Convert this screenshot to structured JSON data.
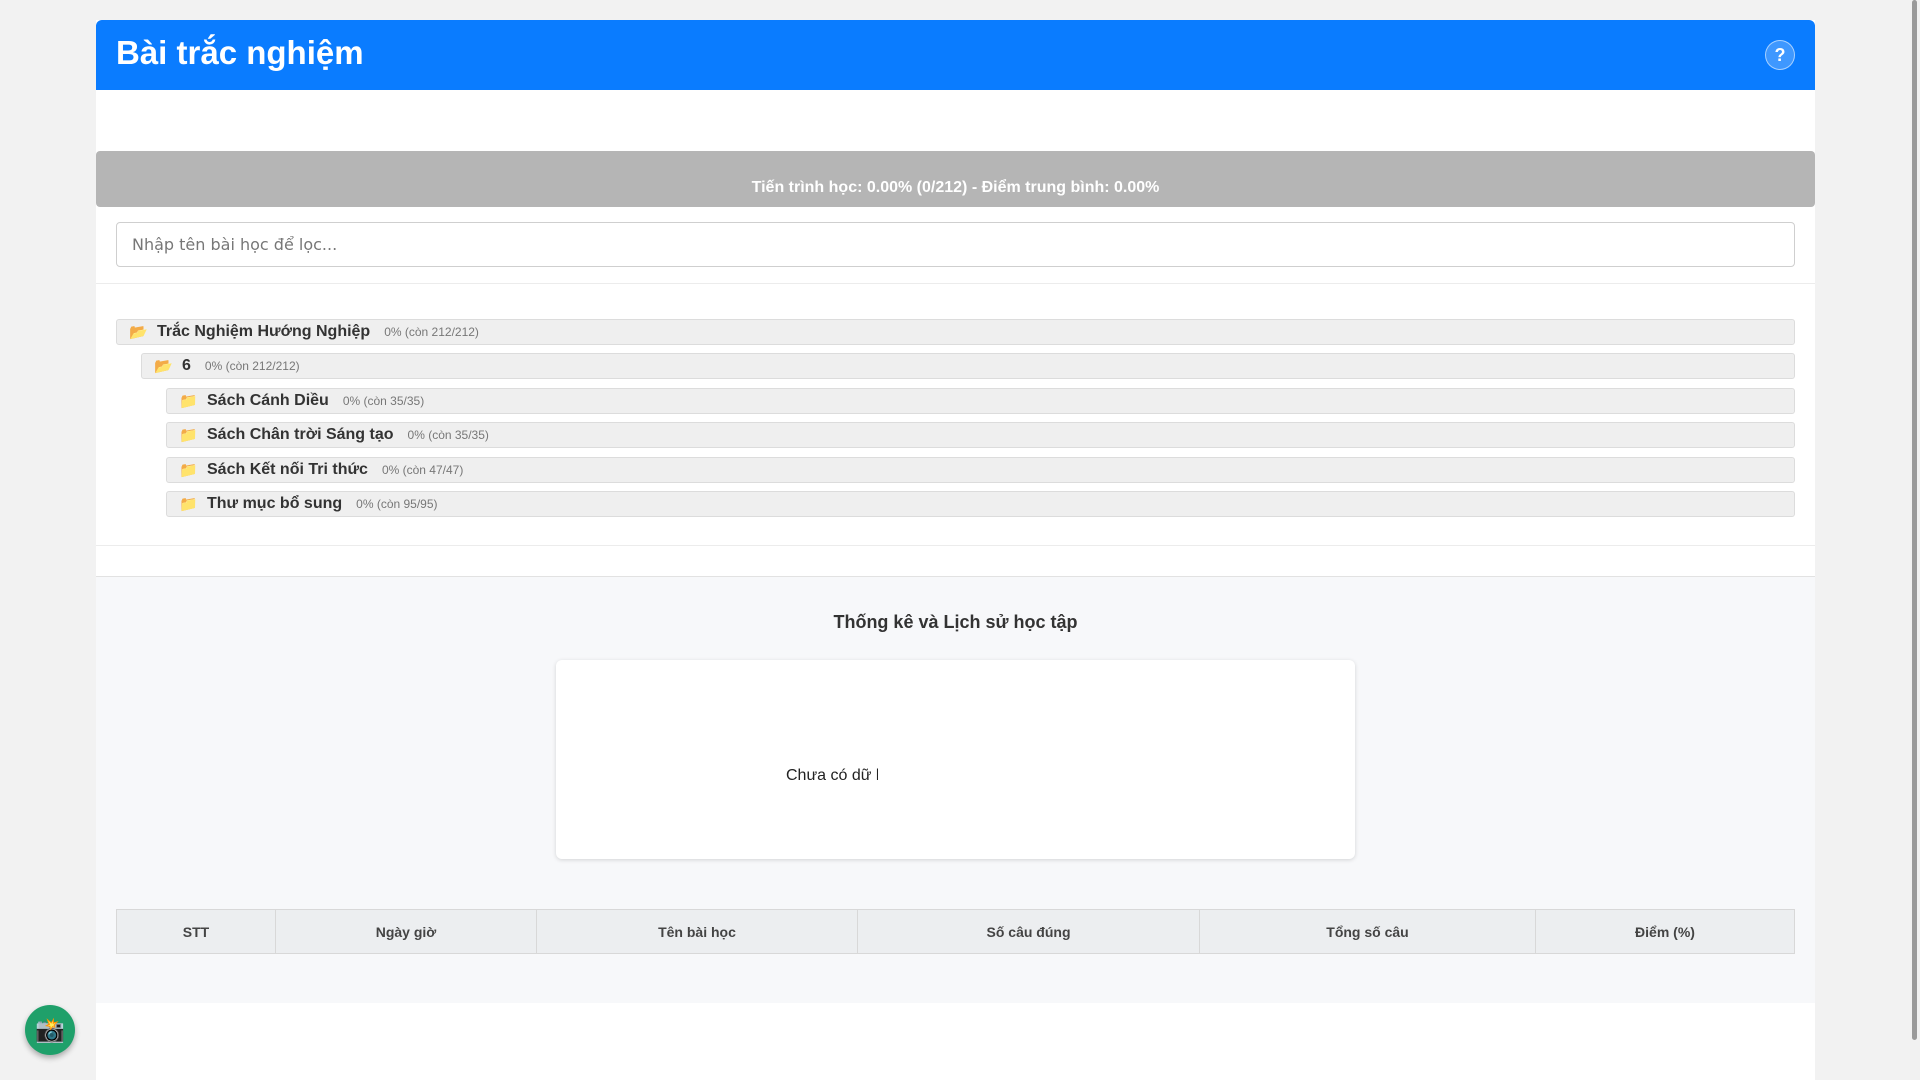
{
  "header": {
    "title": "Bài trắc nghiệm",
    "help_label": "?"
  },
  "progress": {
    "text": "Tiến trình học: 0.00% (0/212) - Điểm trung bình: 0.00%",
    "fraction": 0.0,
    "bar_color": "#b5b5b5"
  },
  "filter": {
    "placeholder": "Nhập tên bài học để lọc...",
    "value": ""
  },
  "tree": {
    "root": {
      "name": "Trắc Nghiệm Hướng Nghiệp",
      "stat": "0% (còn 212/212)",
      "icon": "open-folder-icon"
    },
    "grade": {
      "name": "6",
      "stat": "0% (còn 212/212)",
      "icon": "open-folder-icon"
    },
    "books": [
      {
        "name": "Sách Cánh Diều",
        "stat": "0% (còn 35/35)",
        "icon": "folder-icon"
      },
      {
        "name": "Sách Chân trời Sáng tạo",
        "stat": "0% (còn 35/35)",
        "icon": "folder-icon"
      },
      {
        "name": "Sách Kết nối Tri thức",
        "stat": "0% (còn 47/47)",
        "icon": "folder-icon"
      },
      {
        "name": "Thư mục bổ sung",
        "stat": "0% (còn 95/95)",
        "icon": "folder-icon"
      }
    ]
  },
  "stats": {
    "title": "Thống kê và Lịch sử học tập",
    "chart_empty_text": "Chưa có dữ liệu",
    "table_headers": [
      "STT",
      "Ngày giờ",
      "Tên bài học",
      "Số câu đúng",
      "Tổng số câu",
      "Điểm (%)"
    ]
  },
  "colors": {
    "header": "#0a7cff",
    "camera_button": "#1fa06a"
  },
  "camera": {
    "icon": "camera-icon",
    "glyph": "📸"
  }
}
